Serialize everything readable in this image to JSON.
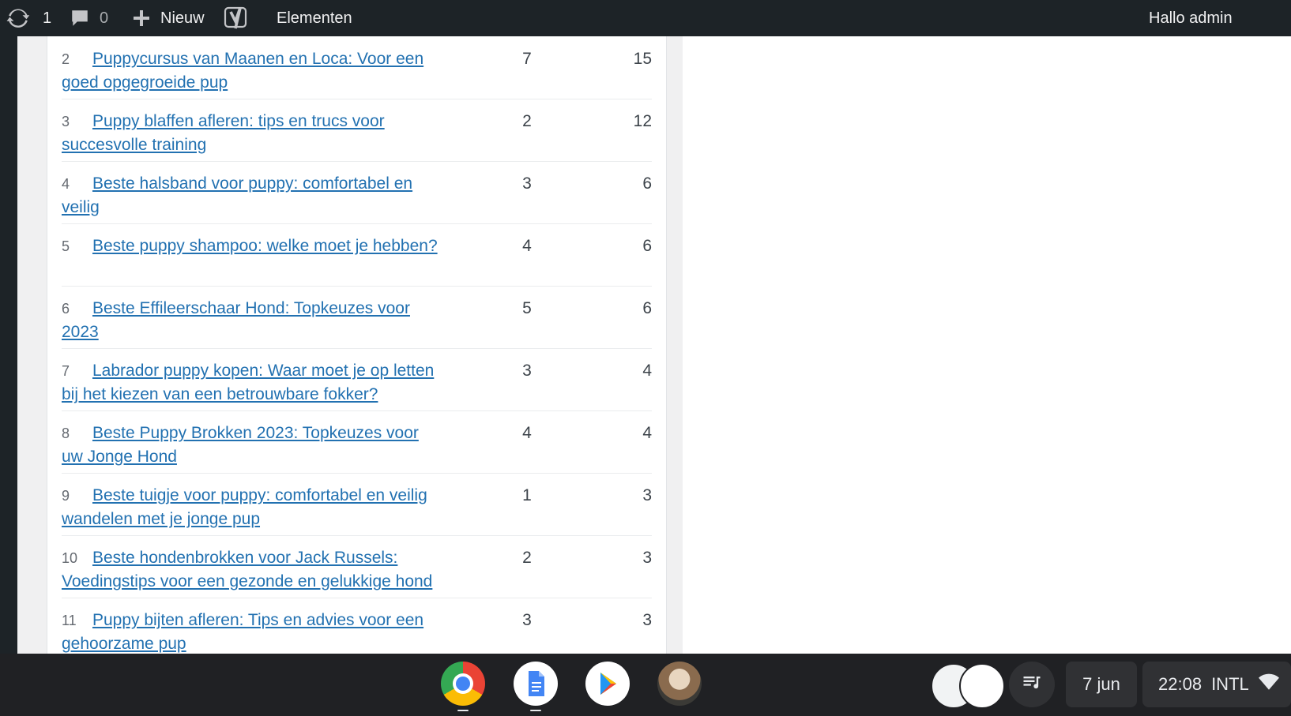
{
  "adminbar": {
    "updates_count": "1",
    "comments_count": "0",
    "new_label": "Nieuw",
    "elementor_label": "Elementen",
    "greeting": "Hallo admin"
  },
  "table": {
    "rows": [
      {
        "rank": "2",
        "title": "Puppycursus van Maanen en Loca: Voor een goed opgegroeide pup",
        "col1": "7",
        "col2": "15"
      },
      {
        "rank": "3",
        "title": "Puppy blaffen afleren: tips en trucs voor succesvolle training",
        "col1": "2",
        "col2": "12"
      },
      {
        "rank": "4",
        "title": "Beste halsband voor puppy: comfortabel en veilig",
        "col1": "3",
        "col2": "6"
      },
      {
        "rank": "5",
        "title": "Beste puppy shampoo: welke moet je hebben?",
        "col1": "4",
        "col2": "6"
      },
      {
        "rank": "6",
        "title": "Beste Effileerschaar Hond: Topkeuzes voor 2023",
        "col1": "5",
        "col2": "6"
      },
      {
        "rank": "7",
        "title": "Labrador puppy kopen: Waar moet je op letten bij het kiezen van een betrouwbare fokker?",
        "col1": "3",
        "col2": "4"
      },
      {
        "rank": "8",
        "title": "Beste Puppy Brokken 2023: Topkeuzes voor uw Jonge Hond",
        "col1": "4",
        "col2": "4"
      },
      {
        "rank": "9",
        "title": "Beste tuigje voor puppy: comfortabel en veilig wandelen met je jonge pup",
        "col1": "1",
        "col2": "3"
      },
      {
        "rank": "10",
        "title": "Beste hondenbrokken voor Jack Russels: Voedingstips voor een gezonde en gelukkige hond",
        "col1": "2",
        "col2": "3"
      },
      {
        "rank": "11",
        "title": "Puppy bijten afleren: Tips en advies voor een gehoorzame pup",
        "col1": "3",
        "col2": "3"
      }
    ]
  },
  "shelf": {
    "apps": [
      "chrome-icon",
      "google-docs-icon",
      "play-store-icon",
      "profile-avatar-icon"
    ],
    "date": "7 jun",
    "time": "22:08",
    "input_method": "INTL"
  },
  "colors": {
    "adminbar_bg": "#1d2327",
    "link": "#2271b1",
    "shelf_bg": "#202124"
  }
}
